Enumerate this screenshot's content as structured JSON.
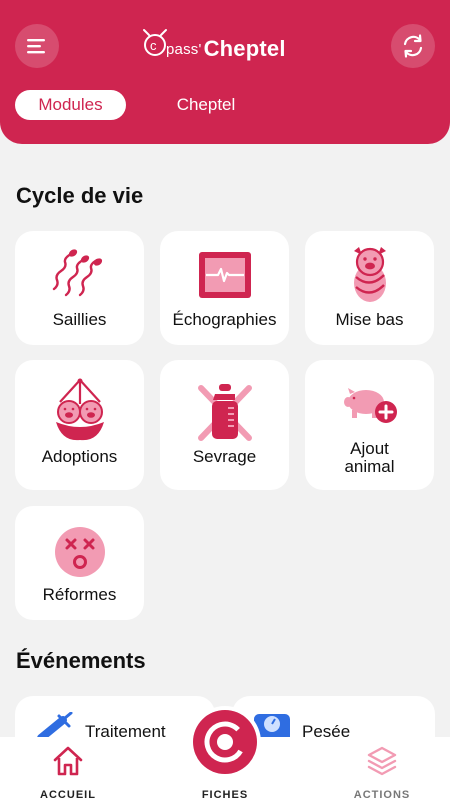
{
  "header": {
    "logo_prefix": "pass'",
    "logo_name": "Cheptel",
    "tabs": [
      {
        "label": "Modules",
        "active": true
      },
      {
        "label": "Cheptel",
        "active": false
      }
    ]
  },
  "sections": {
    "cycle_title": "Cycle de vie",
    "events_title": "Événements"
  },
  "cycle_cards": [
    {
      "label": "Saillies",
      "icon": "sperm-icon"
    },
    {
      "label": "Échographies",
      "icon": "ultrasound-monitor-icon"
    },
    {
      "label": "Mise bas",
      "icon": "swaddled-piglet-icon"
    },
    {
      "label": "Adoptions",
      "icon": "piglets-bundle-icon"
    },
    {
      "label": "Sevrage",
      "icon": "crossed-bottle-icon"
    },
    {
      "label_line1": "Ajout",
      "label_line2": "animal",
      "icon": "pig-add-icon"
    },
    {
      "label": "Réformes",
      "icon": "dead-face-icon"
    }
  ],
  "event_cards": [
    {
      "label": "Traitement",
      "icon": "syringe-icon"
    },
    {
      "label": "Pesée",
      "icon": "scale-icon"
    }
  ],
  "bottom_nav": {
    "home_label": "ACCUEIL",
    "center_label": "FICHES",
    "actions_label": "ACTIONS"
  },
  "colors": {
    "brand": "#cf2550",
    "brand_light": "#f29bb3",
    "background": "#f2f2f2"
  }
}
